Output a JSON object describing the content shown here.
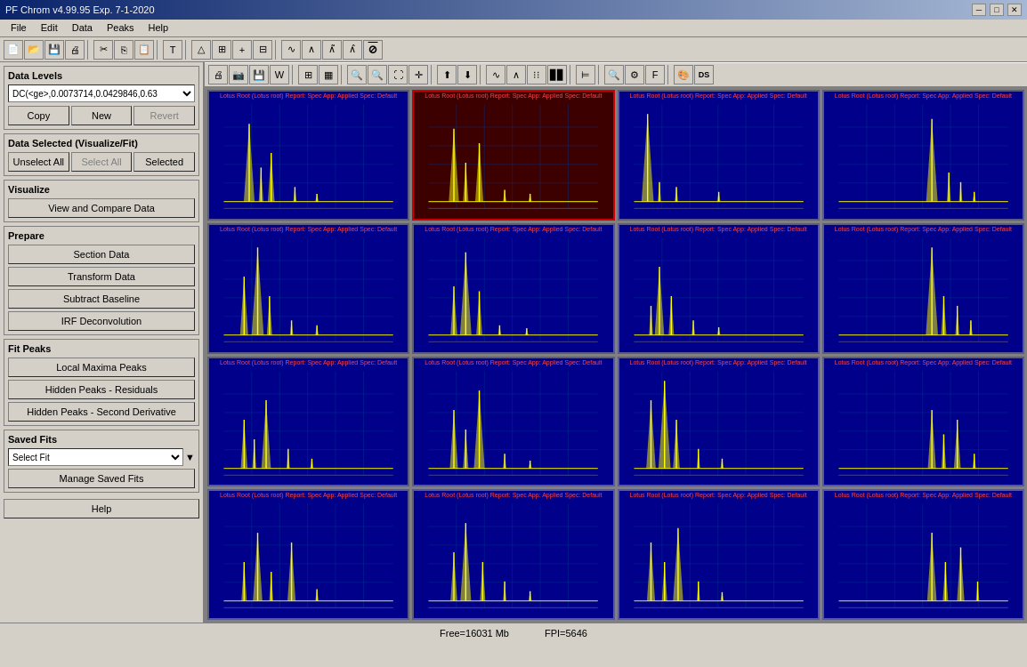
{
  "titlebar": {
    "title": "PF Chrom v4.99.95 Exp. 7-1-2020",
    "controls": [
      "minimize",
      "maximize",
      "close"
    ]
  },
  "menubar": {
    "items": [
      "File",
      "Edit",
      "Data",
      "Peaks",
      "Help"
    ]
  },
  "toolbar1": {
    "buttons": [
      "new-file",
      "open",
      "save",
      "print",
      "cut",
      "copy-tb",
      "paste",
      "undo",
      "redo",
      "bold",
      "italic",
      "draw",
      "grid",
      "add-point",
      "remove-point",
      "curve",
      "curve2",
      "curve3",
      "curve4",
      "filter"
    ]
  },
  "toolbar2": {
    "buttons": [
      "print2",
      "screenshot",
      "save2",
      "word",
      "table",
      "table2",
      "zoom-in",
      "zoom-out",
      "zoom-fit",
      "move",
      "up",
      "down",
      "wave1",
      "wave2",
      "scatter",
      "bar",
      "lines",
      "label",
      "search",
      "color-picker",
      "tool1",
      "tool2",
      "tool3",
      "color-wheel",
      "ds"
    ]
  },
  "left_panel": {
    "data_levels": {
      "label": "Data Levels",
      "value": "DC(<ge>,0.0073714,0.0429846,0.63"
    },
    "buttons": {
      "copy": "Copy",
      "new": "New",
      "revert": "Revert"
    },
    "data_selected": {
      "label": "Data Selected (Visualize/Fit)",
      "unselect_all": "Unselect All",
      "select_all": "Select All",
      "selected": "Selected"
    },
    "visualize": {
      "label": "Visualize",
      "view_compare": "View and Compare Data"
    },
    "prepare": {
      "label": "Prepare",
      "section_data": "Section Data",
      "transform_data": "Transform Data",
      "subtract_baseline": "Subtract Baseline",
      "irf_deconvolution": "IRF Deconvolution"
    },
    "fit_peaks": {
      "label": "Fit Peaks",
      "local_maxima": "Local Maxima Peaks",
      "hidden_residuals": "Hidden Peaks - Residuals",
      "hidden_second": "Hidden Peaks - Second Derivative"
    },
    "saved_fits": {
      "label": "Saved Fits",
      "select_fit": "Select Fit",
      "manage_saved_fits": "Manage Saved Fits"
    },
    "help": "Help"
  },
  "charts": {
    "rows": 4,
    "cols": 4,
    "selected_index": 1,
    "label": "Lotus Root (Lotus root) Report: Spec App: Applied Spec: Default"
  },
  "statusbar": {
    "free": "Free=16031 Mb",
    "fpi": "FPI=5646"
  }
}
